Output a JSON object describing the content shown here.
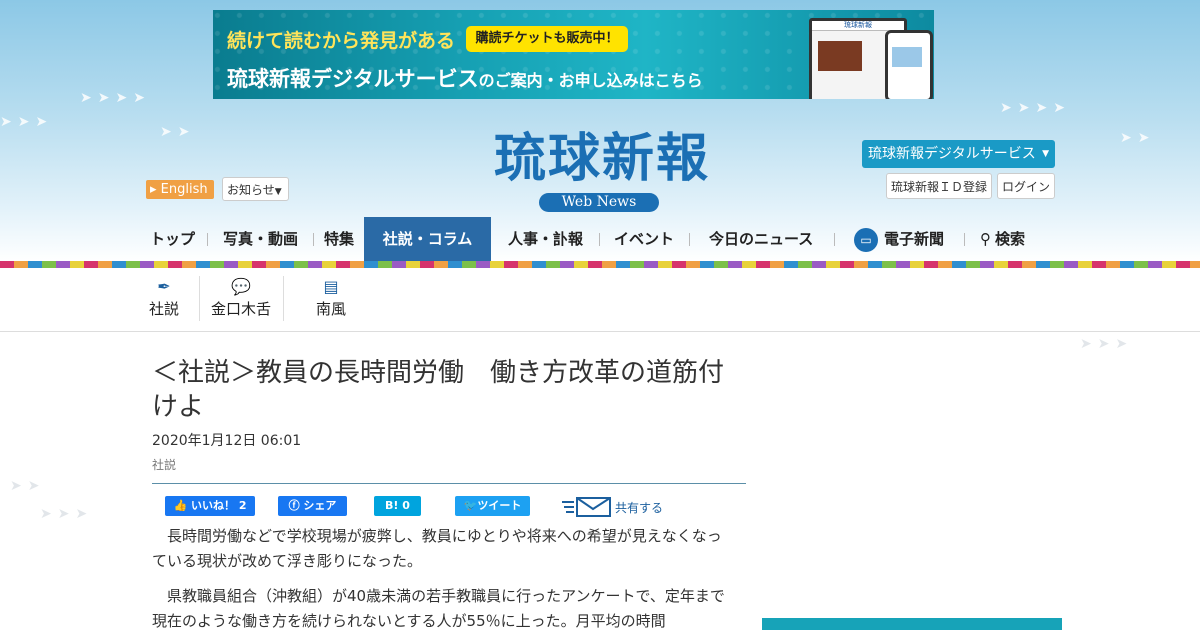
{
  "ad_banner": {
    "line1": "続けて読むから発見がある",
    "pill": "購読チケットも販売中！",
    "line2a": "琉球新報デジタルサービス",
    "line2b": "のご案内・お申し込み",
    "line2c": "はこちら",
    "device_title": "琉球新報"
  },
  "header": {
    "logo": "琉球新報",
    "logo_sub": "Web News",
    "english": "English",
    "notice": "お知らせ",
    "digital": "琉球新報デジタルサービス",
    "id_register": "琉球新報ＩＤ登録",
    "login": "ログイン"
  },
  "nav": {
    "top": "トップ",
    "photo": "写真・動画",
    "special": "特集",
    "editorial": "社説・コラム",
    "personnel": "人事・訃報",
    "event": "イベント",
    "today": "今日のニュース",
    "epaper": "電子新聞",
    "search": "検索"
  },
  "subnav": {
    "shasetsu": "社説",
    "kinkuchi": "金口木舌",
    "nanpu": "南風"
  },
  "article": {
    "title": "＜社説＞教員の長時間労働　働き方改革の道筋付けよ",
    "date": "2020年1月12日 06:01",
    "category": "社説",
    "paragraphs": [
      "　長時間労働などで学校現場が疲弊し、教員にゆとりや将来への希望が見えなくなっている現状が改めて浮き彫りになった。",
      "　県教職員組合（沖教組）が40歳未満の若手教職員に行ったアンケートで、定年まで現在のような働き方を続けられないとする人が55％に上った。月平均の時間"
    ]
  },
  "share": {
    "like": "いいね！ 2",
    "fb_share": "シェア",
    "hatena": "B! 0",
    "tweet": "ツイート",
    "share_label": "共有する"
  },
  "colors": {
    "brand_blue": "#1b6fb4",
    "nav_active": "#2a6aa6",
    "facebook": "#1877f2",
    "hatena": "#00a4de",
    "twitter": "#1da1f2",
    "english_btn": "#f0a044",
    "digital_btn": "#1a9ac6"
  }
}
